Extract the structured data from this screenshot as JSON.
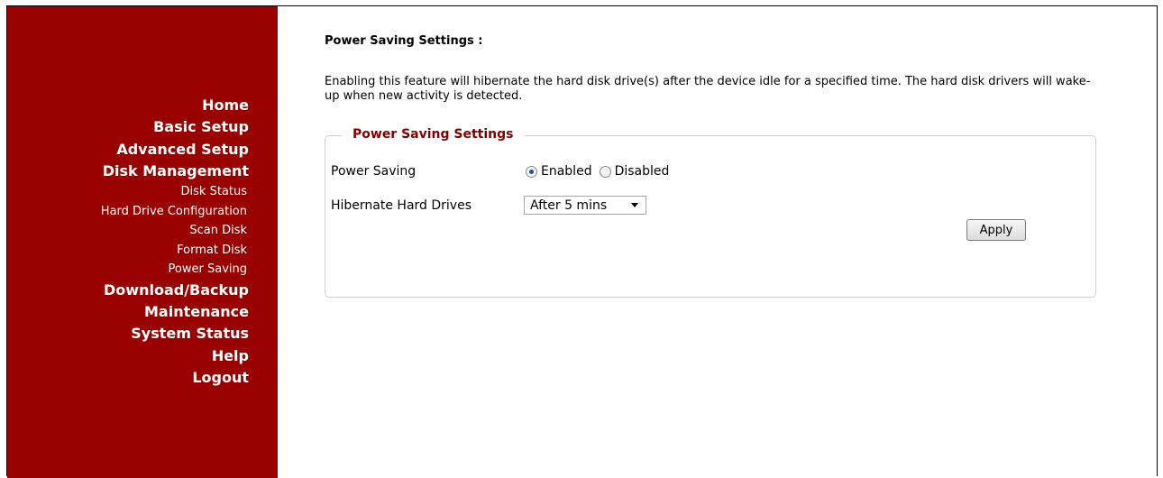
{
  "nav": {
    "items": [
      {
        "label": "Home",
        "level": "main"
      },
      {
        "label": "Basic Setup",
        "level": "main"
      },
      {
        "label": "Advanced Setup",
        "level": "main"
      },
      {
        "label": "Disk Management",
        "level": "main"
      },
      {
        "label": "Disk Status",
        "level": "sub"
      },
      {
        "label": "Hard Drive Configuration",
        "level": "sub"
      },
      {
        "label": "Scan Disk",
        "level": "sub"
      },
      {
        "label": "Format Disk",
        "level": "sub"
      },
      {
        "label": "Power Saving",
        "level": "sub"
      },
      {
        "label": "Download/Backup",
        "level": "main"
      },
      {
        "label": "Maintenance",
        "level": "main"
      },
      {
        "label": "System Status",
        "level": "main"
      },
      {
        "label": "Help",
        "level": "main"
      },
      {
        "label": "Logout",
        "level": "main"
      }
    ]
  },
  "page": {
    "title": "Power Saving Settings :",
    "description": "Enabling this feature will hibernate the hard disk drive(s) after the device idle for a specified time. The hard disk drivers will wake-up when new activity is detected."
  },
  "settings": {
    "legend": "Power Saving Settings",
    "power_saving": {
      "label": "Power Saving",
      "enabled_label": "Enabled",
      "disabled_label": "Disabled",
      "selected": "Enabled"
    },
    "hibernate": {
      "label": "Hibernate Hard Drives",
      "value": "After 5 mins"
    },
    "apply_label": "Apply"
  },
  "colors": {
    "sidebar": "#990000",
    "legend": "#800000"
  }
}
